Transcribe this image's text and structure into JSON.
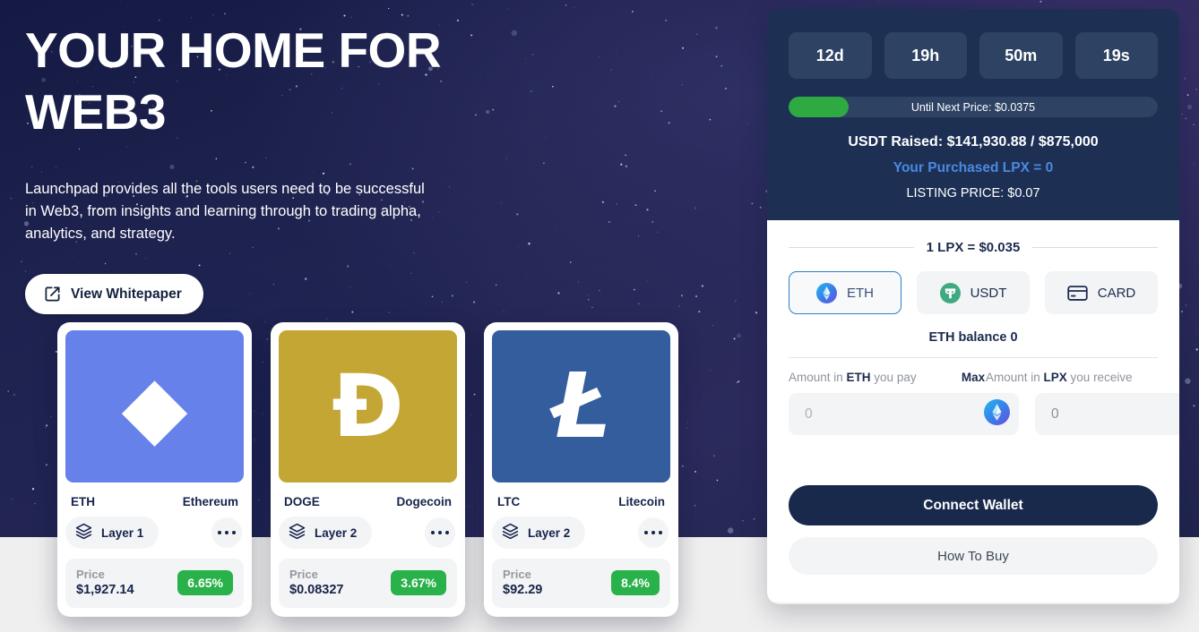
{
  "hero": {
    "headline": "YOUR HOME FOR WEB3",
    "subcopy": "Launchpad provides all the tools users need to be successful in Web3, from insights and learning through to trading alpha, analytics, and strategy.",
    "whitepaper_label": "View Whitepaper"
  },
  "coins": [
    {
      "symbol": "ETH",
      "name": "Ethereum",
      "glyph": "◆",
      "bg": "#6781ea",
      "layer": "Layer 1",
      "price_label": "Price",
      "price": "$1,927.14",
      "change": "6.65%",
      "change_color": "#29b24a"
    },
    {
      "symbol": "DOGE",
      "name": "Dogecoin",
      "glyph": "Ð",
      "bg": "#c4a634",
      "layer": "Layer 2",
      "price_label": "Price",
      "price": "$0.08327",
      "change": "3.67%",
      "change_color": "#29b24a"
    },
    {
      "symbol": "LTC",
      "name": "Litecoin",
      "glyph": "Ł",
      "bg": "#345d9d",
      "layer": "Layer 2",
      "price_label": "Price",
      "price": "$92.29",
      "change": "8.4%",
      "change_color": "#29b24a"
    }
  ],
  "panel": {
    "countdown": [
      {
        "value": "12d"
      },
      {
        "value": "19h"
      },
      {
        "value": "50m"
      },
      {
        "value": "19s"
      }
    ],
    "progress": {
      "text": "Until Next Price: $0.0375",
      "percent": 16.2,
      "fill_color": "#2faa43",
      "track_color": "#2e4264"
    },
    "raised": "USDT Raised: $141,930.88 / $875,000",
    "purchased": "Your Purchased LPX = 0",
    "purchased_color": "#4b89e0",
    "listing_price": "LISTING PRICE: $0.07",
    "rate": "1 LPX = $0.035",
    "pay_methods": [
      {
        "label": "ETH",
        "icon": "eth-coin-icon",
        "selected": true
      },
      {
        "label": "USDT",
        "icon": "usdt-coin-icon",
        "selected": false
      },
      {
        "label": "CARD",
        "icon": "credit-card-icon",
        "selected": false
      }
    ],
    "balance": "ETH balance 0",
    "pay_label_prefix": "Amount in ",
    "pay_label_token": "ETH",
    "pay_label_suffix": " you pay",
    "max_label": "Max",
    "receive_label_prefix": "Amount in ",
    "receive_label_token": "LPX",
    "receive_label_suffix": " you receive",
    "pay_input_value": "",
    "pay_input_placeholder": "0",
    "receive_input_value": "0",
    "receive_input_placeholder": "0",
    "connect_label": "Connect Wallet",
    "howto_label": "How To Buy",
    "top_bg": "#1d3054",
    "connect_bg": "#19294c"
  }
}
